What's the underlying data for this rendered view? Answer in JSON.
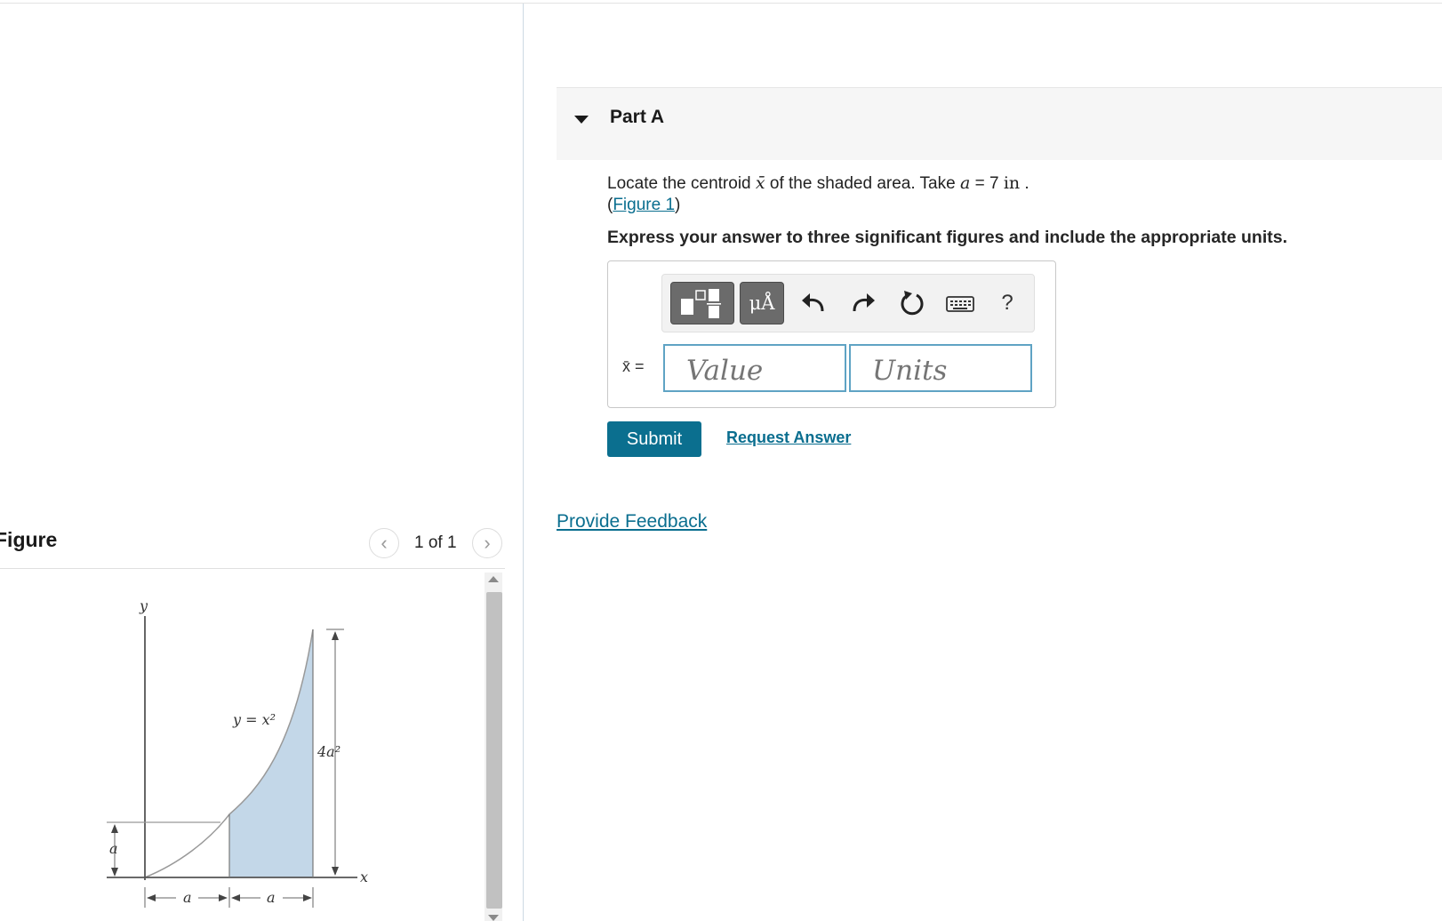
{
  "figure_panel": {
    "title": "Figure",
    "counter": "1 of 1",
    "prev_icon": "chevron-left-icon",
    "next_icon": "chevron-right-icon",
    "labels": {
      "y_axis": "y",
      "x_axis": "x",
      "curve": "y = x²",
      "height": "4a²",
      "left_height": "a",
      "dim_left": "a",
      "dim_right": "a"
    },
    "shade_color": "#c3d7e8"
  },
  "part": {
    "title": "Part A",
    "prompt": {
      "before": "Locate the centroid ",
      "symbol": "x̄",
      "middle": " of the shaded area. Take ",
      "var": "a",
      "eq": " = 7 ",
      "unit": "in",
      "end": " ."
    },
    "figure_link": {
      "open": "(",
      "text": "Figure 1",
      "close": ")"
    },
    "instruction": "Express your answer to three significant figures and include the appropriate units.",
    "answer": {
      "variable_label": "x̄ =",
      "value_placeholder": "Value",
      "units_placeholder": "Units",
      "units_button": "μÅ",
      "help_button": "?",
      "toolbar_icons": [
        "templates-icon",
        "units-icon",
        "undo-icon",
        "redo-icon",
        "reset-icon",
        "keyboard-icon",
        "help-icon"
      ]
    },
    "submit_label": "Submit",
    "request_answer_label": "Request Answer"
  },
  "feedback_label": "Provide Feedback",
  "colors": {
    "accent": "#0b6f8f",
    "link": "#0a6e8f",
    "field_border": "#5fa3c4"
  }
}
